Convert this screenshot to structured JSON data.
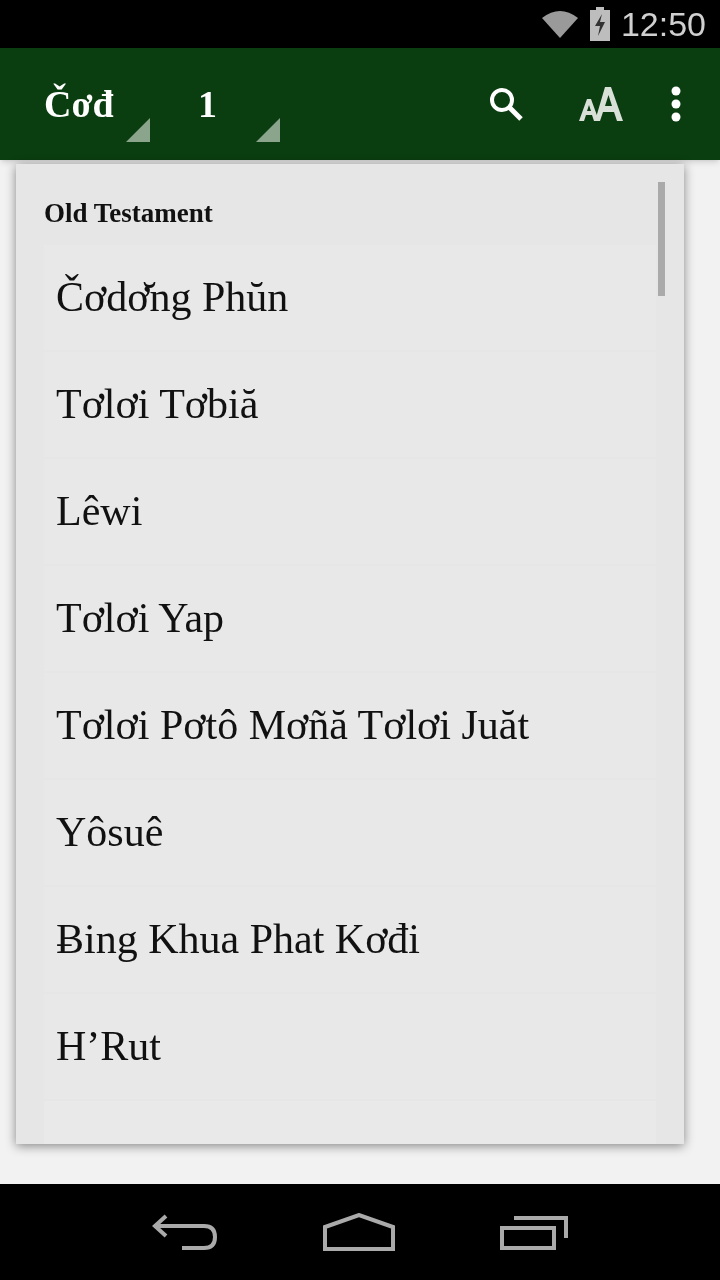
{
  "status_bar": {
    "time": "12:50"
  },
  "toolbar": {
    "book": "Čơđ",
    "chapter": "1"
  },
  "book_menu": {
    "section": "Old Testament",
    "items": [
      {
        "label": "Čơdơ̆ng Phŭn"
      },
      {
        "label": "Tơlơi Tơbiă"
      },
      {
        "label": "Lêwi"
      },
      {
        "label": "Tơlơi Yap"
      },
      {
        "label": "Tơlơi Pơtô Mơñă Tơlơi Juăt"
      },
      {
        "label": "Yôsuê"
      },
      {
        "label": "Ƀing Khua Phat Kơđi"
      },
      {
        "label": "H’Rut"
      }
    ]
  }
}
